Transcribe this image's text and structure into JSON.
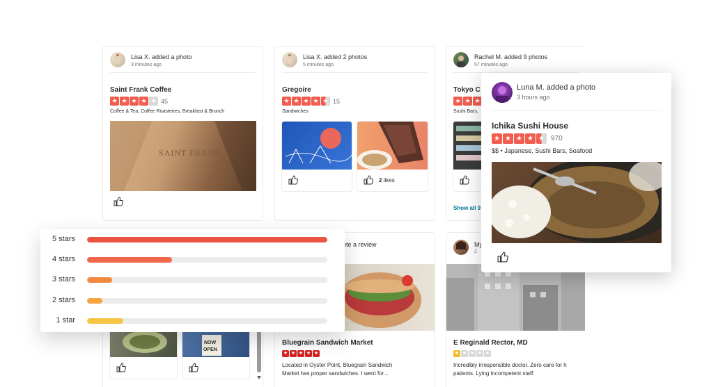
{
  "feed": {
    "cards": [
      {
        "activity": "Lisa X. added a photo",
        "time": "3 minutes ago",
        "business": "Saint Frank Coffee",
        "review_count": "45",
        "categories": "Coffee & Tea, Coffee Roasteries, Breakfast & Brunch",
        "photo_caption": "SAINT FRANK"
      },
      {
        "activity": "Lisa X. added 2 photos",
        "time": "5 minutes ago",
        "business": "Gregoire",
        "review_count": "15",
        "categories": "Sandwiches",
        "likes_count": "2",
        "likes_word": "likes"
      },
      {
        "activity": "Rachel M. added 9 photos",
        "time": "57 minutes ago",
        "business": "Tokyo C",
        "categories": "Sushi Bars,",
        "show_all": "Show all 9"
      },
      {
        "activity": "ote a review",
        "business": "Bluegrain Sandwich Market",
        "snippet_1": "Located in Oyster Point, Bluegrain Sandwich",
        "snippet_2": "Market has proper sandwiches. I went for..."
      },
      {
        "activity": "My",
        "time": "2",
        "business": "E Reginald Rector, MD",
        "snippet_1": "Incredibly irresponsible doctor. Zero care for h",
        "snippet_2": "patients. Lying incompetent staff."
      },
      {
        "sign_1": "NOW",
        "sign_2": "OPEN"
      }
    ]
  },
  "popup": {
    "activity": "Luna M. added a photo",
    "time": "3 hours ago",
    "business": "Ichika Sushi House",
    "review_count": "970",
    "price": "$$",
    "separator": "•",
    "categories": "Japanese, Sushi Bars, Seafood"
  },
  "rating_breakdown": {
    "rows": [
      {
        "label": "5 stars",
        "fraction": 1.0,
        "color": "#e95340"
      },
      {
        "label": "4 stars",
        "fraction": 0.355,
        "color": "#f0674a"
      },
      {
        "label": "3 stars",
        "fraction": 0.105,
        "color": "#f08a3e"
      },
      {
        "label": "2 stars",
        "fraction": 0.065,
        "color": "#f5a53f"
      },
      {
        "label": "1 star",
        "fraction": 0.15,
        "color": "#f5c543"
      }
    ]
  },
  "colors": {
    "star_red": "#f15c4f",
    "link": "#027a97",
    "text": "#2d2e2f"
  },
  "icons": [
    "thumbs-up-icon",
    "star-icon"
  ]
}
